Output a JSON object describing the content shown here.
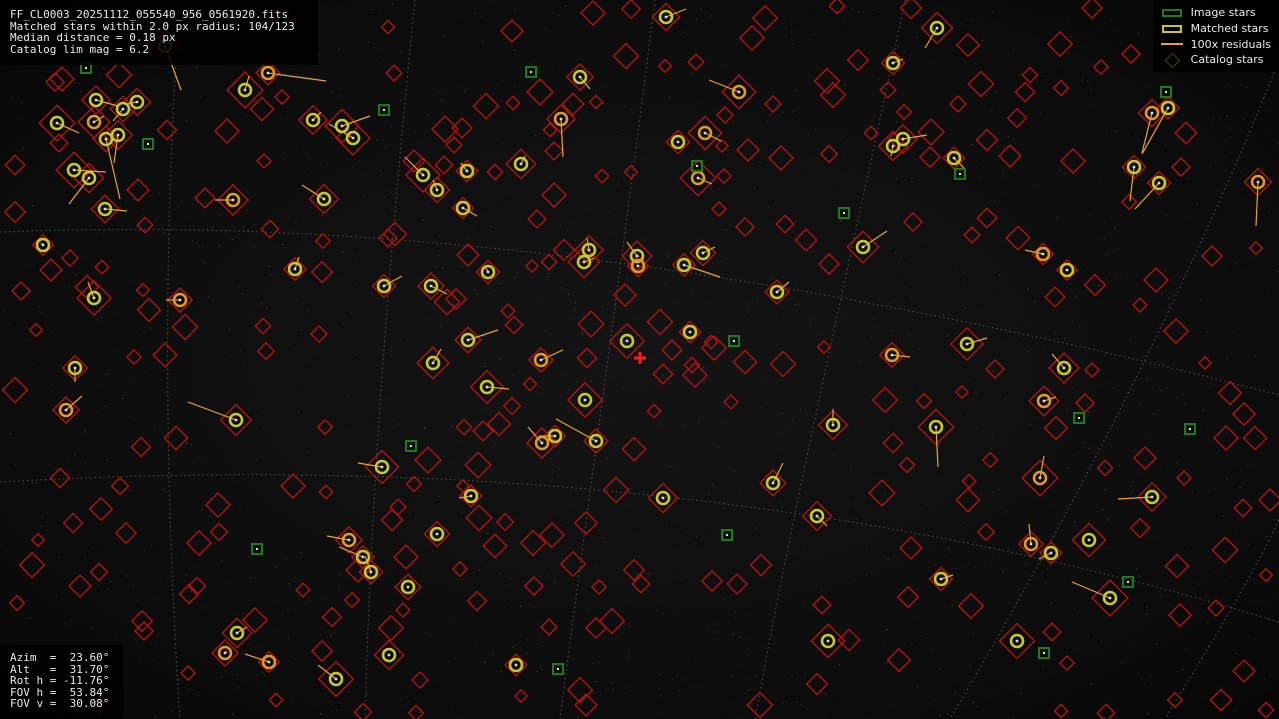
{
  "header": {
    "filename": "FF_CL0003_20251112_055540_956_0561920.fits",
    "matched": "Matched stars within 2.0 px radius: 104/123",
    "median": "Median distance = 0.18 px",
    "catalog": "Catalog lim mag = 6.2"
  },
  "legend": {
    "image_stars": "Image stars",
    "matched_stars": "Matched stars",
    "residuals": "100x residuals",
    "catalog_stars": "Catalog stars"
  },
  "pointing": {
    "azim": "Azim  =  23.60°",
    "alt": "Alt   =  31.70°",
    "rot": "Rot h = -11.76°",
    "fov_h": "FOV h =  53.84°",
    "fov_v": "FOV v =  30.08°"
  },
  "colors": {
    "image_star": "#1d7a1d",
    "matched_star": "#c8c830",
    "residual": "#e8a33a",
    "catalog_star": "#b01414",
    "center_marker": "#ff1a1a"
  }
}
